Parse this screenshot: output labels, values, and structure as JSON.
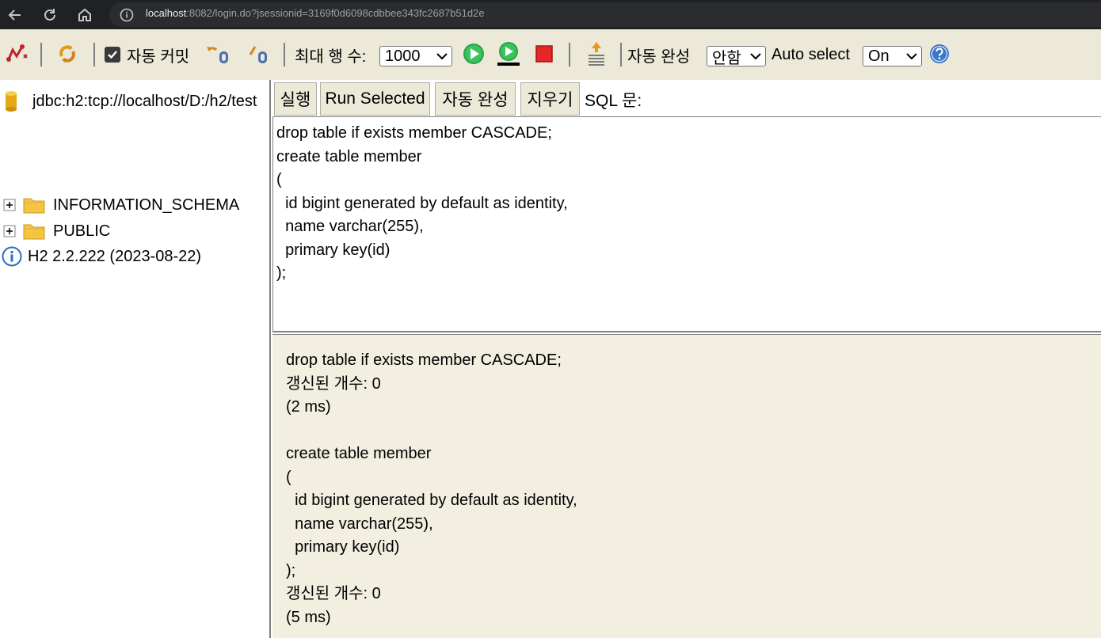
{
  "browser": {
    "url_host": "localhost",
    "url_rest": ":8082/login.do?jsessionid=3169f0d6098cdbbee343fc2687b51d2e"
  },
  "toolbar": {
    "auto_commit_label": "자동 커밋",
    "auto_commit_checked": true,
    "max_rows_label": "최대 행 수:",
    "max_rows_value": "1000",
    "auto_complete_label": "자동 완성",
    "auto_complete_value": "안함",
    "auto_select_label": "Auto select",
    "auto_select_value": "On"
  },
  "tree": {
    "connection": "jdbc:h2:tcp://localhost/D:/h2/test",
    "schemas": [
      "INFORMATION_SCHEMA",
      "PUBLIC"
    ],
    "version": "H2 2.2.222 (2023-08-22)"
  },
  "sql_buttons": {
    "run": "실행",
    "run_selected": "Run Selected",
    "auto_complete": "자동 완성",
    "clear": "지우기",
    "sql_label": "SQL 문:"
  },
  "editor_text": "drop table if exists member CASCADE;\ncreate table member\n(\n  id bigint generated by default as identity,\n  name varchar(255),\n  primary key(id)\n);",
  "result_text": "drop table if exists member CASCADE;\n갱신된 개수: 0\n(2 ms)\n\ncreate table member\n(\n  id bigint generated by default as identity,\n  name varchar(255),\n  primary key(id)\n);\n갱신된 개수: 0\n(5 ms)",
  "colors": {
    "toolbar_bg": "#ece9d8",
    "result_bg": "#f2efe0",
    "chrome_bg": "#202124"
  }
}
